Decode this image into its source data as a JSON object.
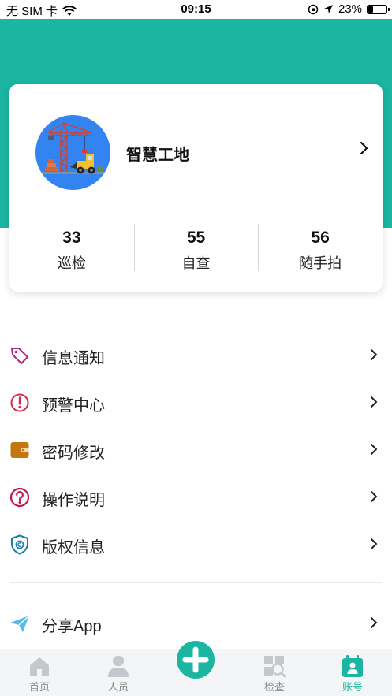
{
  "status_bar": {
    "carrier": "无 SIM 卡",
    "time": "09:15",
    "battery_percent_text": "23%",
    "battery_level": 0.23
  },
  "profile": {
    "name": "智慧工地",
    "stats": [
      {
        "value": "33",
        "label": "巡检"
      },
      {
        "value": "55",
        "label": "自查"
      },
      {
        "value": "56",
        "label": "随手拍"
      }
    ]
  },
  "menu": {
    "items": [
      {
        "label": "信息通知",
        "icon": "tag-icon",
        "color": "#b0287a"
      },
      {
        "label": "预警中心",
        "icon": "alert-icon",
        "color": "#d12a4a"
      },
      {
        "label": "密码修改",
        "icon": "wallet-icon",
        "color": "#c2780e"
      },
      {
        "label": "操作说明",
        "icon": "help-icon",
        "color": "#c0184a"
      },
      {
        "label": "版权信息",
        "icon": "copyright-shield-icon",
        "color": "#1a7ea8"
      }
    ],
    "share": {
      "label": "分享App",
      "icon": "paper-plane-icon",
      "color": "#5bb8e8"
    }
  },
  "tabbar": {
    "tabs": [
      {
        "label": "首页",
        "icon": "home-icon"
      },
      {
        "label": "人员",
        "icon": "person-icon"
      },
      {
        "label": "检查",
        "icon": "inspect-icon"
      },
      {
        "label": "账号",
        "icon": "account-icon",
        "active": true
      }
    ],
    "add_icon": "plus-icon"
  },
  "colors": {
    "accent": "#1bb5a2",
    "inactive_tab": "#c4c8cc"
  }
}
